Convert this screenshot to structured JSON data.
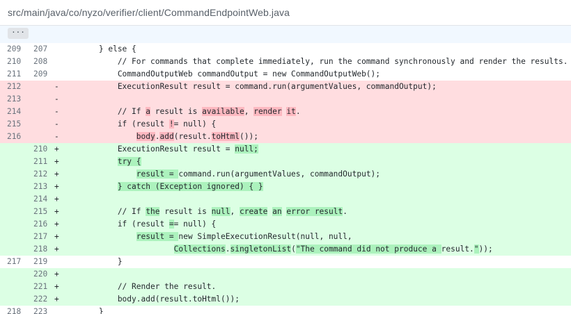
{
  "file": {
    "path": "src/main/java/co/nyzo/verifier/client/CommandEndpointWeb.java",
    "expand_label": "···"
  },
  "lines": [
    {
      "type": "ctx",
      "old": "209",
      "new": "207",
      "sign": "",
      "segments": [
        {
          "t": "        } else {"
        }
      ]
    },
    {
      "type": "ctx",
      "old": "210",
      "new": "208",
      "sign": "",
      "segments": [
        {
          "t": "            // For commands that complete immediately, run the command synchronously and render the results."
        }
      ]
    },
    {
      "type": "ctx",
      "old": "211",
      "new": "209",
      "sign": "",
      "segments": [
        {
          "t": "            CommandOutputWeb commandOutput = new CommandOutputWeb();"
        }
      ]
    },
    {
      "type": "del",
      "old": "212",
      "new": "",
      "sign": "-",
      "segments": [
        {
          "t": "            ExecutionResult result = command.run(argumentValues, commandOutput);"
        }
      ]
    },
    {
      "type": "del",
      "old": "213",
      "new": "",
      "sign": "-",
      "segments": [
        {
          "t": ""
        }
      ]
    },
    {
      "type": "del",
      "old": "214",
      "new": "",
      "sign": "-",
      "segments": [
        {
          "t": "            // If "
        },
        {
          "t": "a",
          "h": 1
        },
        {
          "t": " result is "
        },
        {
          "t": "available",
          "h": 1
        },
        {
          "t": ", "
        },
        {
          "t": "render",
          "h": 1
        },
        {
          "t": " "
        },
        {
          "t": "it",
          "h": 1
        },
        {
          "t": "."
        }
      ]
    },
    {
      "type": "del",
      "old": "215",
      "new": "",
      "sign": "-",
      "segments": [
        {
          "t": "            if (result "
        },
        {
          "t": "!",
          "h": 1
        },
        {
          "t": "= null) {"
        }
      ]
    },
    {
      "type": "del",
      "old": "216",
      "new": "",
      "sign": "-",
      "segments": [
        {
          "t": "                "
        },
        {
          "t": "body",
          "h": 1
        },
        {
          "t": "."
        },
        {
          "t": "add",
          "h": 1
        },
        {
          "t": "(result."
        },
        {
          "t": "toHtml",
          "h": 1
        },
        {
          "t": "());"
        }
      ]
    },
    {
      "type": "add",
      "old": "",
      "new": "210",
      "sign": "+",
      "segments": [
        {
          "t": "            ExecutionResult result = "
        },
        {
          "t": "null;",
          "h": 1
        }
      ]
    },
    {
      "type": "add",
      "old": "",
      "new": "211",
      "sign": "+",
      "segments": [
        {
          "t": "            "
        },
        {
          "t": "try {",
          "h": 1
        }
      ]
    },
    {
      "type": "add",
      "old": "",
      "new": "212",
      "sign": "+",
      "segments": [
        {
          "t": "                "
        },
        {
          "t": "result = ",
          "h": 1
        },
        {
          "t": "command.run(argumentValues, commandOutput);"
        }
      ]
    },
    {
      "type": "add",
      "old": "",
      "new": "213",
      "sign": "+",
      "segments": [
        {
          "t": "            "
        },
        {
          "t": "} catch (Exception ignored) { }",
          "h": 1
        }
      ]
    },
    {
      "type": "add",
      "old": "",
      "new": "214",
      "sign": "+",
      "segments": [
        {
          "t": ""
        }
      ]
    },
    {
      "type": "add",
      "old": "",
      "new": "215",
      "sign": "+",
      "segments": [
        {
          "t": "            // If "
        },
        {
          "t": "the",
          "h": 1
        },
        {
          "t": " result is "
        },
        {
          "t": "null",
          "h": 1
        },
        {
          "t": ", "
        },
        {
          "t": "create",
          "h": 1
        },
        {
          "t": " "
        },
        {
          "t": "an",
          "h": 1
        },
        {
          "t": " "
        },
        {
          "t": "error result",
          "h": 1
        },
        {
          "t": "."
        }
      ]
    },
    {
      "type": "add",
      "old": "",
      "new": "216",
      "sign": "+",
      "segments": [
        {
          "t": "            if (result "
        },
        {
          "t": "=",
          "h": 1
        },
        {
          "t": "= null) {"
        }
      ]
    },
    {
      "type": "add",
      "old": "",
      "new": "217",
      "sign": "+",
      "segments": [
        {
          "t": "                "
        },
        {
          "t": "result = ",
          "h": 1
        },
        {
          "t": "new SimpleExecutionResult(null, null,"
        }
      ]
    },
    {
      "type": "add",
      "old": "",
      "new": "218",
      "sign": "+",
      "segments": [
        {
          "t": "                        "
        },
        {
          "t": "Collections",
          "h": 1
        },
        {
          "t": "."
        },
        {
          "t": "singletonList",
          "h": 1
        },
        {
          "t": "("
        },
        {
          "t": "\"The command did not produce a ",
          "h": 1
        },
        {
          "t": "result."
        },
        {
          "t": "\"",
          "h": 1
        },
        {
          "t": "));"
        }
      ]
    },
    {
      "type": "ctx",
      "old": "217",
      "new": "219",
      "sign": "",
      "segments": [
        {
          "t": "            }"
        }
      ]
    },
    {
      "type": "add",
      "old": "",
      "new": "220",
      "sign": "+",
      "segments": [
        {
          "t": ""
        }
      ]
    },
    {
      "type": "add",
      "old": "",
      "new": "221",
      "sign": "+",
      "segments": [
        {
          "t": "            // Render the result."
        }
      ]
    },
    {
      "type": "add",
      "old": "",
      "new": "222",
      "sign": "+",
      "segments": [
        {
          "t": "            body.add(result.toHtml());"
        }
      ]
    },
    {
      "type": "ctx",
      "old": "218",
      "new": "223",
      "sign": "",
      "segments": [
        {
          "t": "        }"
        }
      ],
      "cut": true
    }
  ]
}
